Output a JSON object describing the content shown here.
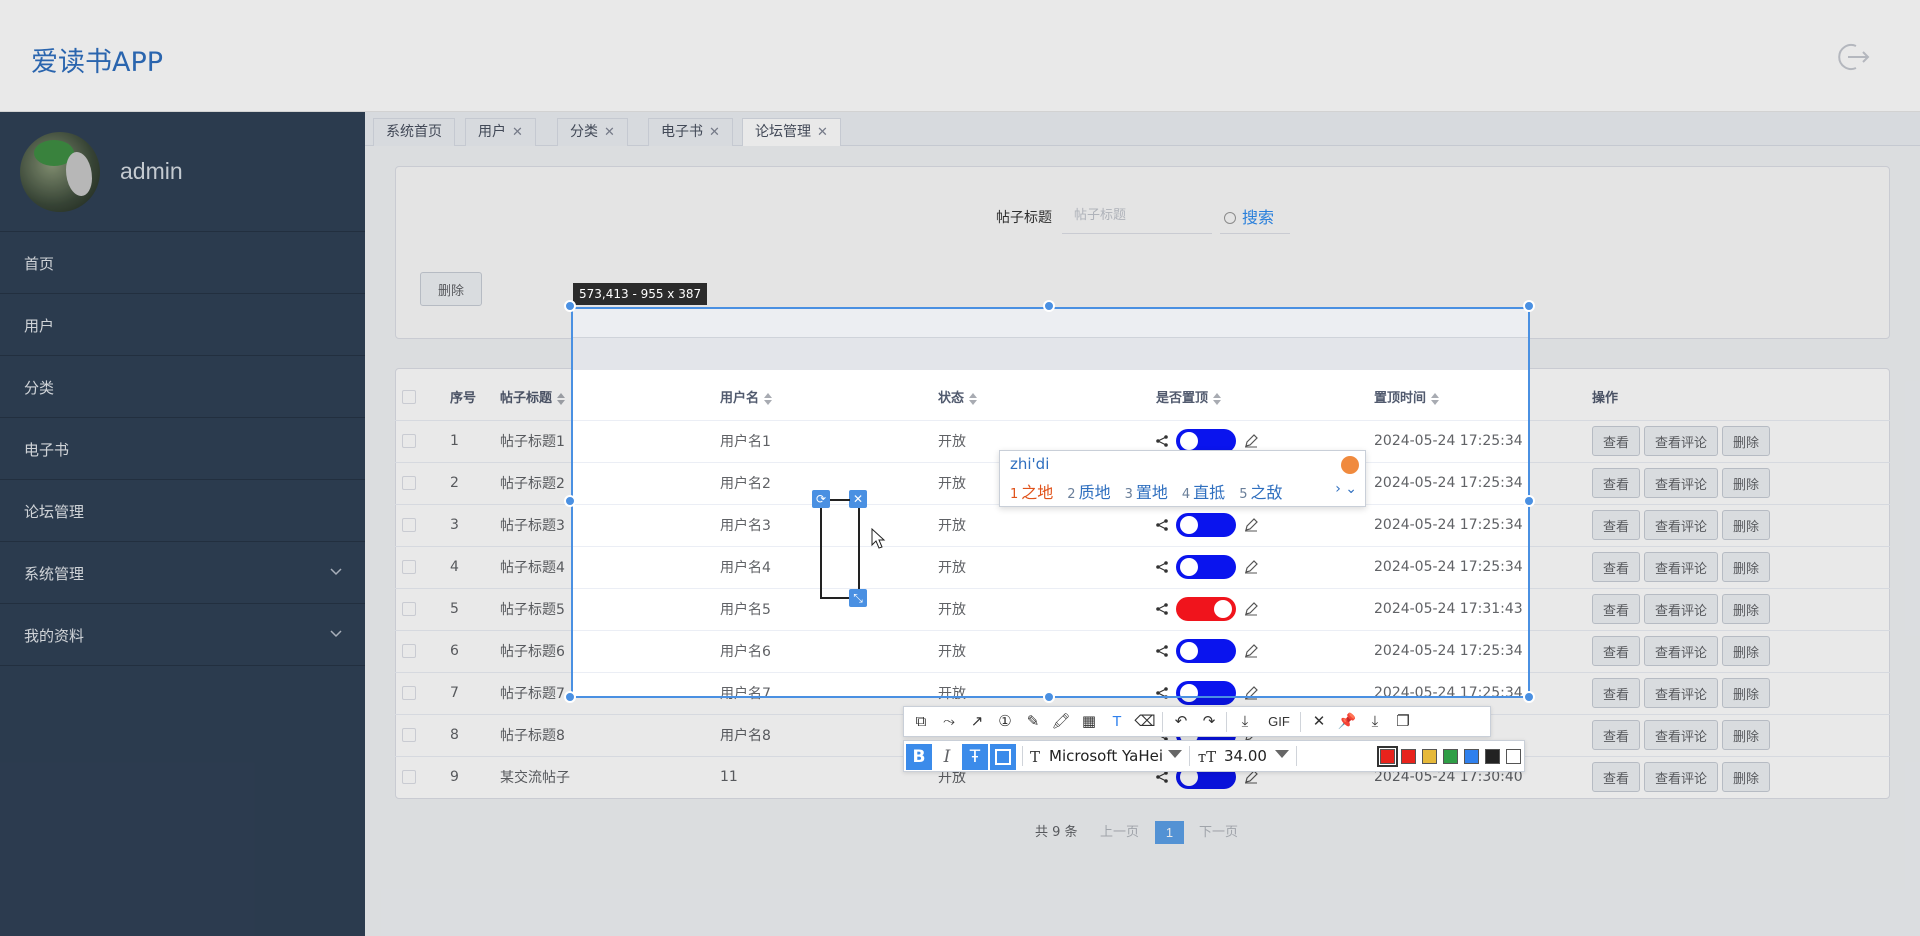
{
  "app": {
    "title": "爱读书APP"
  },
  "sidebar": {
    "username": "admin",
    "items": [
      {
        "label": "首页"
      },
      {
        "label": "用户"
      },
      {
        "label": "分类"
      },
      {
        "label": "电子书"
      },
      {
        "label": "论坛管理"
      },
      {
        "label": "系统管理"
      },
      {
        "label": "我的资料"
      }
    ]
  },
  "tabs": [
    {
      "label": "系统首页"
    },
    {
      "label": "用户"
    },
    {
      "label": "分类"
    },
    {
      "label": "电子书"
    },
    {
      "label": "论坛管理"
    }
  ],
  "search": {
    "label": "帖子标题",
    "placeholder": "帖子标题",
    "button": "搜索",
    "batch_delete": "删除"
  },
  "table": {
    "headers": [
      "序号",
      "帖子标题",
      "用户名",
      "状态",
      "是否置顶",
      "置顶时间",
      "操作"
    ],
    "rows": [
      {
        "no": "1",
        "title": "帖子标题1",
        "user": "用户名1",
        "status": "开放",
        "top": false,
        "time": "2024-05-24 17:25:34"
      },
      {
        "no": "2",
        "title": "帖子标题2",
        "user": "用户名2",
        "status": "开放",
        "top": false,
        "time": "2024-05-24 17:25:34"
      },
      {
        "no": "3",
        "title": "帖子标题3",
        "user": "用户名3",
        "status": "开放",
        "top": false,
        "time": "2024-05-24 17:25:34"
      },
      {
        "no": "4",
        "title": "帖子标题4",
        "user": "用户名4",
        "status": "开放",
        "top": false,
        "time": "2024-05-24 17:25:34"
      },
      {
        "no": "5",
        "title": "帖子标题5",
        "user": "用户名5",
        "status": "开放",
        "top": true,
        "time": "2024-05-24 17:31:43"
      },
      {
        "no": "6",
        "title": "帖子标题6",
        "user": "用户名6",
        "status": "开放",
        "top": false,
        "time": "2024-05-24 17:25:34"
      },
      {
        "no": "7",
        "title": "帖子标题7",
        "user": "用户名7",
        "status": "开放",
        "top": false,
        "time": "2024-05-24 17:25:34"
      },
      {
        "no": "8",
        "title": "帖子标题8",
        "user": "用户名8",
        "status": "",
        "top": false,
        "time": ""
      },
      {
        "no": "9",
        "title": "某交流帖子",
        "user": "11",
        "status": "开放",
        "top": false,
        "time": "2024-05-24 17:30:40"
      }
    ],
    "actions": [
      "查看",
      "查看评论",
      "删除"
    ]
  },
  "pagination": {
    "total": "共 9 条",
    "prev": "上一页",
    "current": "1",
    "next": "下一页"
  },
  "capture": {
    "size_label": "573,413 - 955 x 387",
    "font": "Microsoft YaHei",
    "font_size": "34.00",
    "colors": [
      "#e8231c",
      "#e8231c",
      "#e6b93a",
      "#2f9e46",
      "#2f80ed",
      "#222222",
      "#ffffff"
    ],
    "gif_label": "GIF"
  },
  "ime": {
    "pinyin": "zhi'di",
    "candidates": [
      {
        "n": "1",
        "text": "之地"
      },
      {
        "n": "2",
        "text": "质地"
      },
      {
        "n": "3",
        "text": "置地"
      },
      {
        "n": "4",
        "text": "直抵"
      },
      {
        "n": "5",
        "text": "之敌"
      }
    ]
  }
}
